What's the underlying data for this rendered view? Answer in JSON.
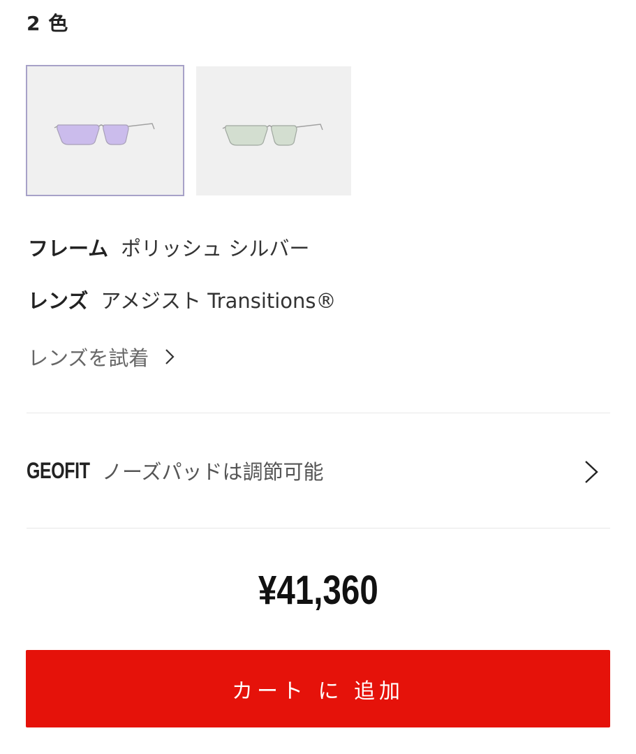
{
  "variants": {
    "count_label": "2 色",
    "items": [
      {
        "name": "purple-lens-variant",
        "lens_color": "#c9b8ea",
        "selected": true
      },
      {
        "name": "green-lens-variant",
        "lens_color": "#cfdccc",
        "selected": false
      }
    ]
  },
  "details": {
    "frame_key": "フレーム",
    "frame_value": "ポリッシュ シルバー",
    "lens_key": "レンズ",
    "lens_value": "アメジスト Transitions®",
    "try_on_label": "レンズを試着"
  },
  "geofit": {
    "brand": "GEOFIT",
    "text": "ノーズパッドは調節可能"
  },
  "price": "¥41,360",
  "cart": {
    "button_label": "カート に 追加",
    "button_color": "#e5120a"
  }
}
